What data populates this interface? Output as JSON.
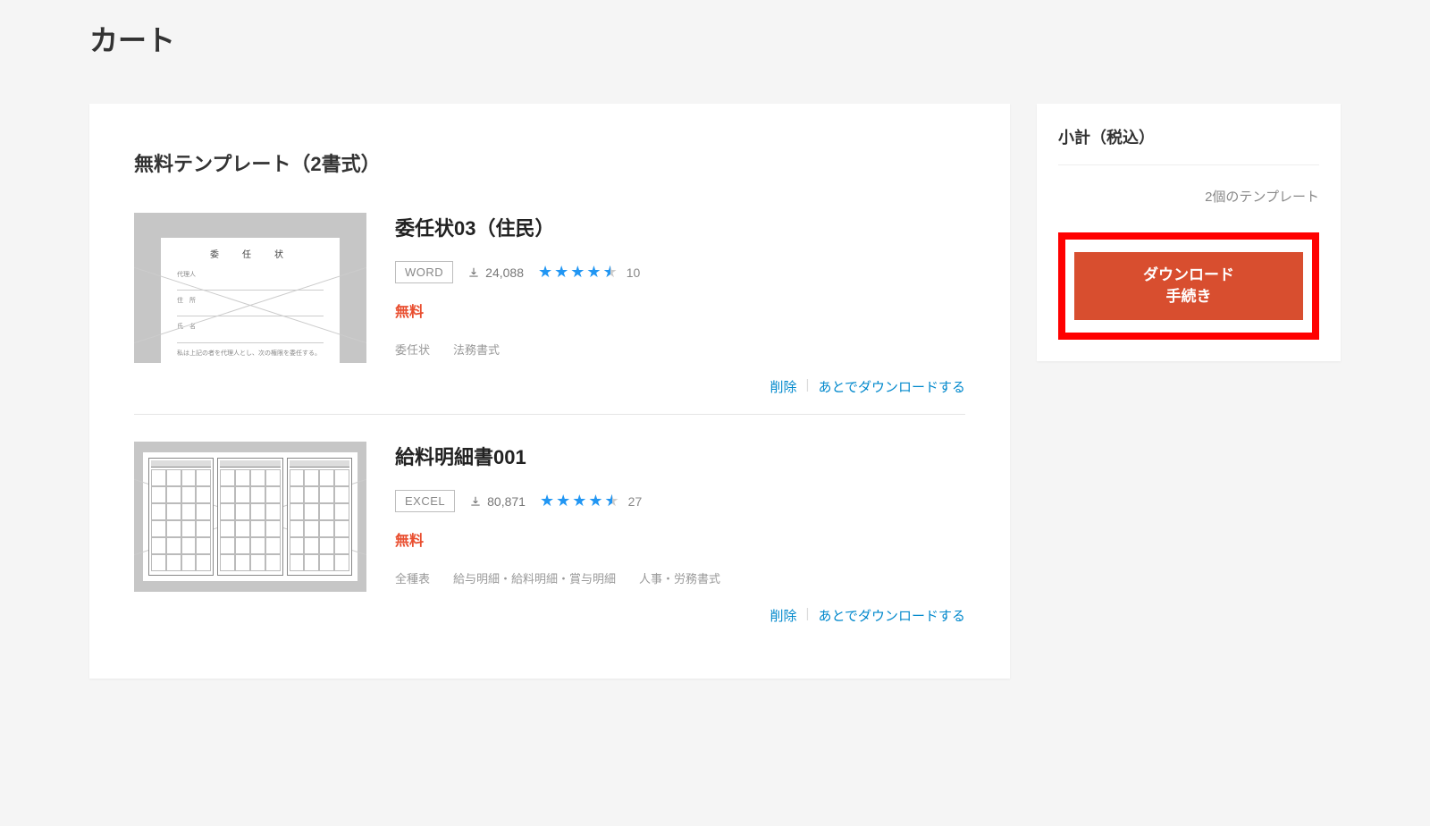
{
  "page_title": "カート",
  "section_heading": "無料テンプレート（2書式）",
  "items": [
    {
      "title": "委任状03（住民）",
      "file_type": "WORD",
      "downloads": "24,088",
      "rating_count": "10",
      "price": "無料",
      "tags_text": "委任状　　法務書式",
      "delete_label": "削除",
      "later_label": "あとでダウンロードする"
    },
    {
      "title": "給料明細書001",
      "file_type": "EXCEL",
      "downloads": "80,871",
      "rating_count": "27",
      "price": "無料",
      "tags_text": "全種表　　給与明細・給料明細・賞与明細　　人事・労務書式",
      "delete_label": "削除",
      "later_label": "あとでダウンロードする"
    }
  ],
  "sidebar": {
    "subtotal_title": "小計（税込）",
    "template_count": "2個のテンプレート",
    "cta_line1": "ダウンロード",
    "cta_line2": "手続き"
  }
}
